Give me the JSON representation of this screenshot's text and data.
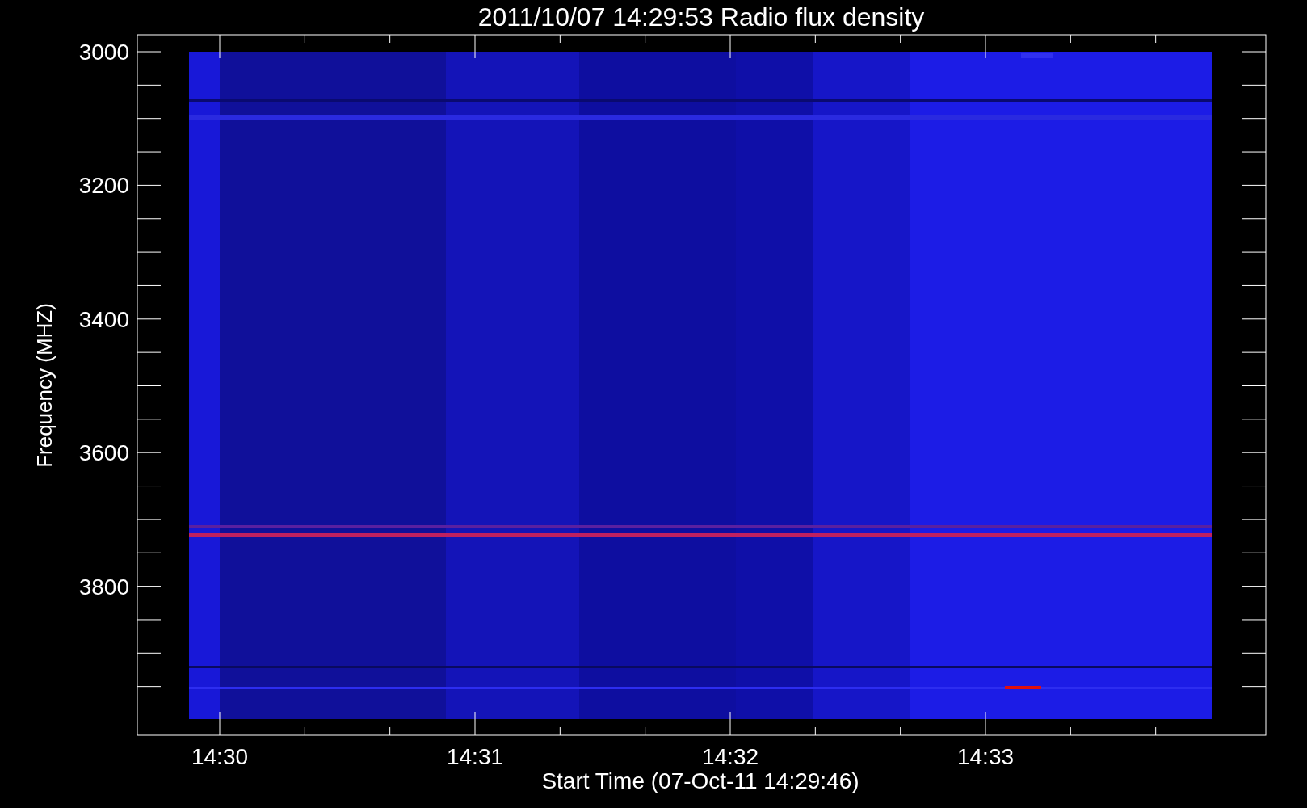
{
  "title": "2011/10/07 14:29:53 Radio flux density",
  "y_axis": {
    "label": "Frequency (MHZ)",
    "ticks": [
      "3000",
      "3200",
      "3400",
      "3600",
      "3800"
    ]
  },
  "x_axis": {
    "label": "Start Time (07-Oct-11 14:29:46)",
    "ticks": [
      "14:30",
      "14:31",
      "14:32",
      "14:33"
    ]
  }
}
